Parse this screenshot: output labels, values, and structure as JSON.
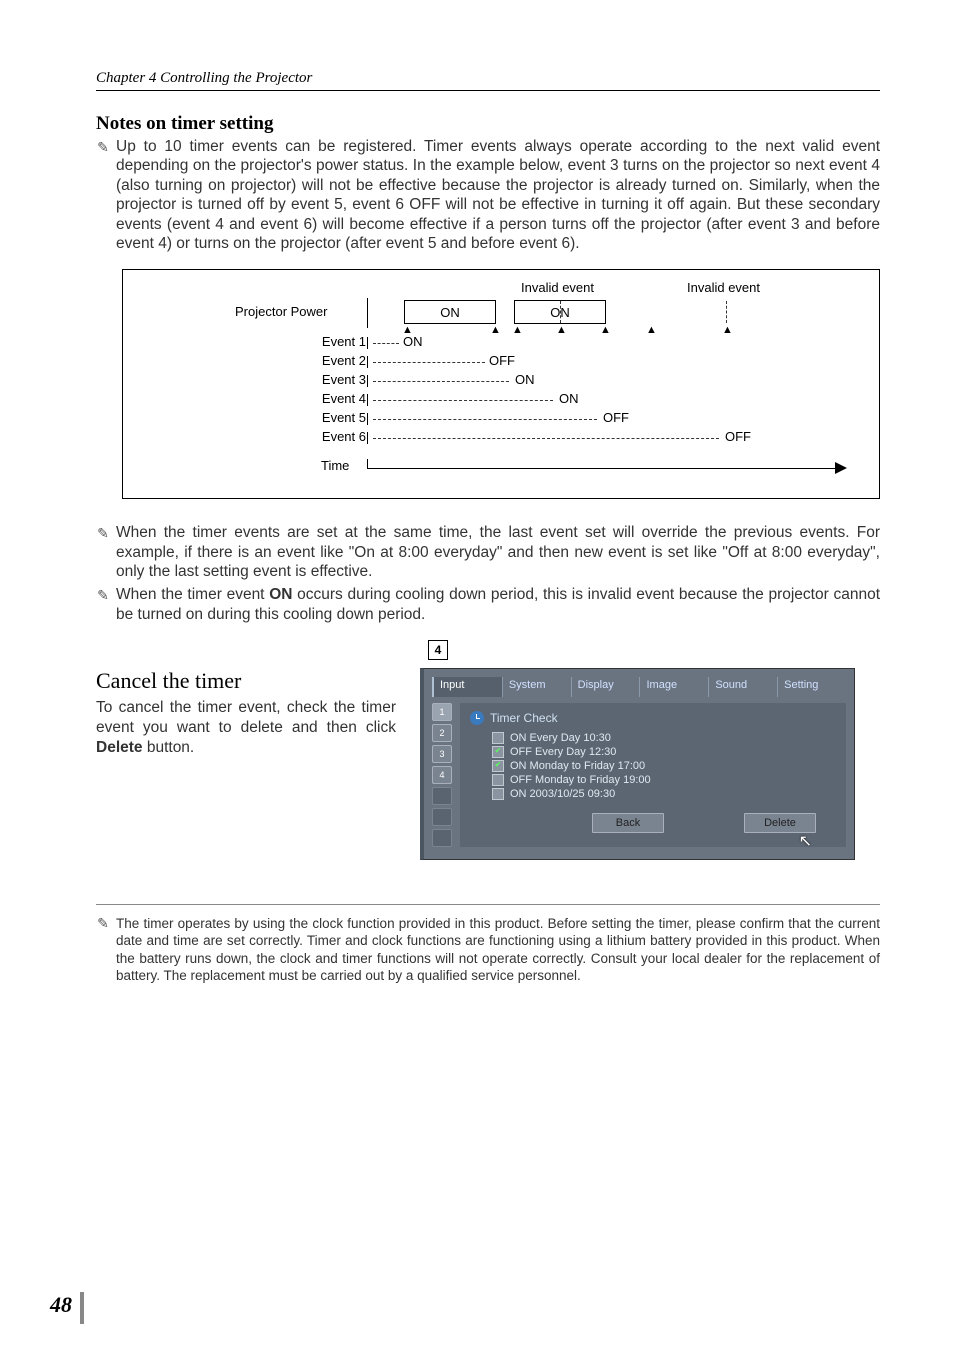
{
  "header": {
    "chapter": "Chapter 4 Controlling the Projector"
  },
  "notes_section": {
    "title": "Notes on timer setting",
    "note1": "Up to 10 timer events can be registered. Timer events always operate according to the next valid event depending on the projector's power status. In the example below, event 3 turns on the projector so next event 4 (also turning on projector) will not be effective because the projector is already turned on. Similarly, when the projector is turned off by event 5, event 6 OFF will not be effective in turning it off again. But these secondary events (event 4 and event 6) will become effective if a person turns off the projector (after event 3 and before event 4) or turns on the projector (after event 5 and before event 6).",
    "note2": "When the timer events are set at the same time, the last event set will override the previous events. For example, if there is an event like \"On at 8:00 everyday\" and then new event is set like \"Off at 8:00 everyday\", only the last setting event is effective.",
    "note3_a": "When the timer event ",
    "note3_bold": "ON",
    "note3_b": " occurs during cooling down period, this is invalid event because the projector cannot be turned on during this cooling down period."
  },
  "diagram": {
    "invalid": "Invalid event",
    "projector_power": "Projector Power",
    "on": "ON",
    "off": "OFF",
    "events": {
      "e1": "Event 1",
      "e2": "Event 2",
      "e3": "Event 3",
      "e4": "Event 4",
      "e5": "Event 5",
      "e6": "Event 6"
    },
    "time": "Time"
  },
  "cancel": {
    "title": "Cancel the timer",
    "text_a": "To cancel the timer event, check the timer event you want to delete and then click ",
    "text_bold": "Delete",
    "text_b": " button."
  },
  "gui": {
    "page_indicator": "4",
    "tabs": {
      "input": "Input",
      "system": "System",
      "display": "Display",
      "image": "Image",
      "sound": "Sound",
      "setting": "Setting"
    },
    "side": {
      "b1": "1",
      "b2": "2",
      "b3": "3",
      "b4": "4"
    },
    "panel_title": "Timer Check",
    "items": {
      "i1": "ON Every Day 10:30",
      "i2": "OFF Every Day 12:30",
      "i3": "ON Monday to Friday 17:00",
      "i4": "OFF Monday to Friday 19:00",
      "i5": "ON 2003/10/25 09:30"
    },
    "back": "Back",
    "delete": "Delete"
  },
  "footnote": {
    "text": "The timer operates by using the clock function provided in this product. Before setting the timer, please confirm that the current date and time are set correctly. Timer and clock functions are functioning using a lithium battery provided in this product. When the battery runs down, the clock and timer functions will not operate correctly. Consult your local dealer for the replacement of battery. The replacement must be carried out by a qualified service personnel."
  },
  "page_number": "48"
}
